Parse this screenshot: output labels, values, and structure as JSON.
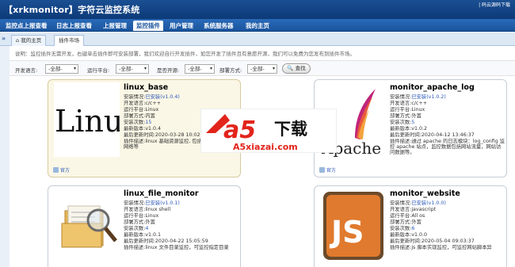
{
  "app": {
    "title": "【xrkmonitor】字符云监控系统",
    "top_link": "| 码云源码下载"
  },
  "nav": {
    "items": [
      {
        "label": "监控点上报查看"
      },
      {
        "label": "日志上报查看"
      },
      {
        "label": "上报管理"
      },
      {
        "label": "监控插件",
        "active": true
      },
      {
        "label": "用户管理"
      },
      {
        "label": "系统服务器"
      },
      {
        "label": "我的主页"
      }
    ]
  },
  "tabs": {
    "collapse": "»",
    "items": [
      {
        "label": "我的主页"
      },
      {
        "label": "插件市场",
        "active": true
      }
    ]
  },
  "description": "说明：监控插件无需开发，右键单击插件即可安装部署，我们欢迎自行开发插件，如您开发了插件且有意愿开源，我们可以免费为您发布到插件市场。",
  "filters": {
    "dev_lang": {
      "label": "开发语言:",
      "value": "-全部-"
    },
    "platform": {
      "label": "运行平台:",
      "value": "-全部-"
    },
    "open_source": {
      "label": "是否开源:",
      "value": "-全部-"
    },
    "deploy": {
      "label": "部署方式:",
      "value": "-全部-"
    },
    "search_button": "查找"
  },
  "cards": [
    {
      "name": "linux_base",
      "highlighted": true,
      "rows": [
        {
          "label": "安装情况:",
          "value": "已安装(v1.0.4)",
          "blue": true
        },
        {
          "label": "开发语言:",
          "value": "c/c++"
        },
        {
          "label": "运行平台:",
          "value": "Linux"
        },
        {
          "label": "部署方式:",
          "value": "内置"
        },
        {
          "label": "安装次数:",
          "value": "15",
          "blue": true
        },
        {
          "label": "最新版本:",
          "value": "v1.0.4"
        },
        {
          "label": "最后更新时间:",
          "value": "2020-03-28 10:02:0"
        }
      ],
      "desc_label": "插件描述:",
      "desc": "linux 基础资源监控, 包括cpu, 内存, 磁盘, 网络等",
      "footer": "官方"
    },
    {
      "name": "monitor_apache_log",
      "highlighted": false,
      "rows": [
        {
          "label": "安装情况:",
          "value": "已安装(v1.0.2)",
          "blue": true
        },
        {
          "label": "开发语言:",
          "value": "c/c++"
        },
        {
          "label": "运行平台:",
          "value": "Linux"
        },
        {
          "label": "部署方式:",
          "value": "外置"
        },
        {
          "label": "安装次数:",
          "value": "5",
          "blue": true
        },
        {
          "label": "最新版本:",
          "value": "v1.0.2"
        },
        {
          "label": "最后更新时间:",
          "value": "2020-04-12 13:46:37"
        }
      ],
      "desc_label": "插件描述:",
      "desc": "通过 apache 的日志模块：log_config 监控 apache 站点，监控数据包括网站流量，网站访问数据等。",
      "footer": "官方"
    },
    {
      "name": "linux_file_monitor",
      "highlighted": false,
      "rows": [
        {
          "label": "安装情况:",
          "value": "已安装(v1.0.1)",
          "blue": true
        },
        {
          "label": "开发语言:",
          "value": "linux shell"
        },
        {
          "label": "运行平台:",
          "value": "Linux"
        },
        {
          "label": "部署方式:",
          "value": "外置"
        },
        {
          "label": "安装次数:",
          "value": "4",
          "blue": true
        },
        {
          "label": "最新版本:",
          "value": "v1.0.1"
        },
        {
          "label": "最后更新时间:",
          "value": "2020-04-22 15:05:59"
        }
      ],
      "desc_label": "插件描述:",
      "desc": "linux 文件目录监控，可监控指定目录",
      "footer": ""
    },
    {
      "name": "monitor_website",
      "highlighted": false,
      "rows": [
        {
          "label": "安装情况:",
          "value": "已安装(v1.0.0)",
          "blue": true
        },
        {
          "label": "开发语言:",
          "value": "javascript"
        },
        {
          "label": "运行平台:",
          "value": "All os"
        },
        {
          "label": "部署方式:",
          "value": "外置"
        },
        {
          "label": "安装次数:",
          "value": "6",
          "blue": true
        },
        {
          "label": "最新版本:",
          "value": "v1.0.0"
        },
        {
          "label": "最后更新时间:",
          "value": "2020-05-04 09:03:37"
        }
      ],
      "desc_label": "插件描述:",
      "desc": "js 脚本实现监控，可监控网站脚本异",
      "footer": ""
    }
  ],
  "images": {
    "linux_text": "Linux",
    "apache_text": "Apache",
    "js_text": "JS"
  },
  "watermark": {
    "brand": "a5",
    "title": "下载",
    "url": "A5xiazai.com"
  },
  "colors": {
    "topbar": "#0d3a78",
    "nav": "#1b559e",
    "link": "#2a57b8",
    "watermark_red": "#e2241b"
  }
}
